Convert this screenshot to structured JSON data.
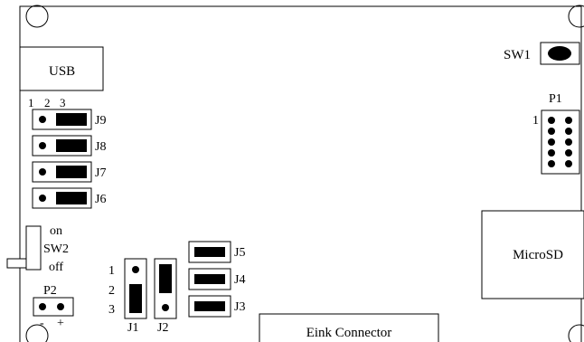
{
  "usb": {
    "label": "USB"
  },
  "jumper_bank": {
    "pin_numbers": [
      "1",
      "2",
      "3"
    ],
    "jumpers": [
      {
        "name": "J9"
      },
      {
        "name": "J8"
      },
      {
        "name": "J7"
      },
      {
        "name": "J6"
      }
    ]
  },
  "sw2": {
    "on_label": "on",
    "name": "SW2",
    "off_label": "off"
  },
  "p2": {
    "name": "P2",
    "minus_label": "-",
    "plus_label": "+"
  },
  "vertical_jumpers": {
    "pin_numbers": [
      "1",
      "2",
      "3"
    ],
    "j1": "J1",
    "j2": "J2"
  },
  "horizontal_jumpers": [
    {
      "name": "J5"
    },
    {
      "name": "J4"
    },
    {
      "name": "J3"
    }
  ],
  "eink": {
    "label": "Eink Connector"
  },
  "sw1": {
    "name": "SW1"
  },
  "p1": {
    "name": "P1",
    "pin1_label": "1"
  },
  "microsd": {
    "label": "MicroSD"
  }
}
